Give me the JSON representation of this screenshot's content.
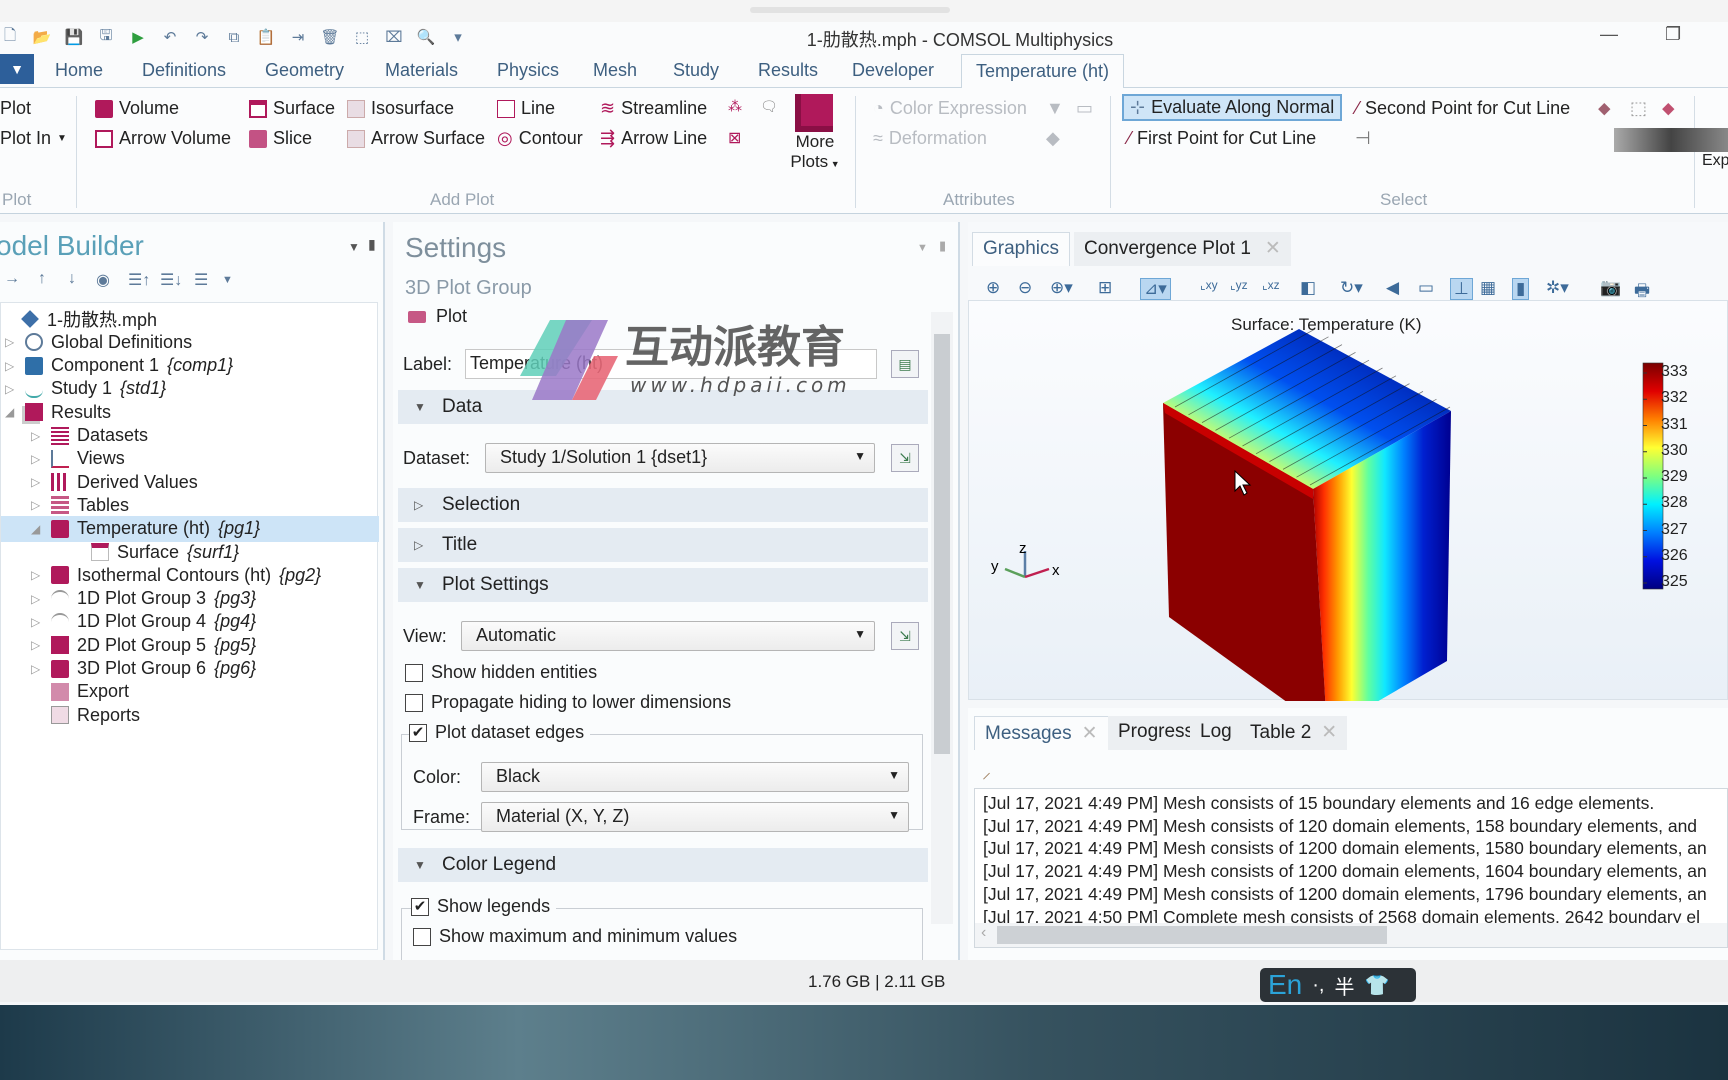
{
  "window": {
    "title": "1-肋散热.mph - COMSOL Multiphysics",
    "minimize_icon": "minimize-icon",
    "restore_icon": "restore-icon"
  },
  "quick_access": [
    "new-file-icon",
    "open-folder-icon",
    "save-icon",
    "save-as-icon",
    "run-icon",
    "undo-icon",
    "redo-icon",
    "copy-icon",
    "paste-icon",
    "duplicate-icon",
    "delete-icon",
    "select-icon",
    "clear-selection-icon",
    "find-icon",
    "dropdown-icon"
  ],
  "ribbon_tabs": [
    {
      "label": "Home"
    },
    {
      "label": "Definitions"
    },
    {
      "label": "Geometry"
    },
    {
      "label": "Materials"
    },
    {
      "label": "Physics"
    },
    {
      "label": "Mesh"
    },
    {
      "label": "Study"
    },
    {
      "label": "Results"
    },
    {
      "label": "Developer"
    },
    {
      "label": "Temperature (ht)",
      "active": true
    }
  ],
  "ribbon": {
    "plot_group": {
      "label": "Plot",
      "plot": "Plot",
      "plot_in": "Plot In"
    },
    "add_plot": {
      "label": "Add Plot",
      "volume": "Volume",
      "surface": "Surface",
      "isosurface": "Isosurface",
      "line": "Line",
      "streamline": "Streamline",
      "arrow_volume": "Arrow Volume",
      "slice": "Slice",
      "arrow_surface": "Arrow Surface",
      "contour": "Contour",
      "arrow_line": "Arrow Line",
      "more_plots_1": "More",
      "more_plots_2": "Plots"
    },
    "attributes": {
      "label": "Attributes",
      "color_expression": "Color Expression",
      "deformation": "Deformation"
    },
    "select": {
      "label": "Select",
      "evaluate_along_normal": "Evaluate Along Normal",
      "second_point": "Second Point for Cut Line",
      "first_point": "First Point for Cut Line"
    },
    "export_partial": "Exp"
  },
  "model_builder": {
    "title": "odel Builder",
    "tree": [
      {
        "label": "1-肋散热.mph",
        "tag": "",
        "level": 0,
        "icon": "model-icon",
        "toggle": ""
      },
      {
        "label": "Global Definitions",
        "tag": "",
        "level": 1,
        "icon": "globe-icon",
        "toggle": "▷"
      },
      {
        "label": "Component 1",
        "tag": "{comp1}",
        "level": 1,
        "icon": "component-icon",
        "toggle": "▷"
      },
      {
        "label": "Study 1",
        "tag": "{std1}",
        "level": 1,
        "icon": "study-icon",
        "toggle": "▷"
      },
      {
        "label": "Results",
        "tag": "",
        "level": 1,
        "icon": "results-icon",
        "toggle": "◢"
      },
      {
        "label": "Datasets",
        "tag": "",
        "level": 2,
        "icon": "datasets-icon",
        "toggle": "▷"
      },
      {
        "label": "Views",
        "tag": "",
        "level": 2,
        "icon": "views-icon",
        "toggle": "▷"
      },
      {
        "label": "Derived Values",
        "tag": "",
        "level": 2,
        "icon": "derived-values-icon",
        "toggle": "▷"
      },
      {
        "label": "Tables",
        "tag": "",
        "level": 2,
        "icon": "tables-icon",
        "toggle": "▷"
      },
      {
        "label": "Temperature (ht)",
        "tag": "{pg1}",
        "level": 2,
        "icon": "plot-group-3d-icon",
        "toggle": "◢",
        "selected": true
      },
      {
        "label": "Surface",
        "tag": "{surf1}",
        "level": 3,
        "icon": "surface-icon",
        "toggle": ""
      },
      {
        "label": "Isothermal Contours (ht)",
        "tag": "{pg2}",
        "level": 2,
        "icon": "plot-group-3d-icon",
        "toggle": "▷"
      },
      {
        "label": "1D Plot Group 3",
        "tag": "{pg3}",
        "level": 2,
        "icon": "plot-group-1d-icon",
        "toggle": "▷"
      },
      {
        "label": "1D Plot Group 4",
        "tag": "{pg4}",
        "level": 2,
        "icon": "plot-group-1d-icon",
        "toggle": "▷"
      },
      {
        "label": "2D Plot Group 5",
        "tag": "{pg5}",
        "level": 2,
        "icon": "plot-group-2d-icon",
        "toggle": "▷"
      },
      {
        "label": "3D Plot Group 6",
        "tag": "{pg6}",
        "level": 2,
        "icon": "plot-group-3d-icon",
        "toggle": "▷"
      },
      {
        "label": "Export",
        "tag": "",
        "level": 2,
        "icon": "export-icon",
        "toggle": ""
      },
      {
        "label": "Reports",
        "tag": "",
        "level": 2,
        "icon": "reports-icon",
        "toggle": ""
      }
    ]
  },
  "settings": {
    "title": "Settings",
    "subtitle": "3D Plot Group",
    "plot_button": "Plot",
    "label_caption": "Label:",
    "label_value": "Temperature (ht)",
    "sections": {
      "data": "Data",
      "selection": "Selection",
      "title": "Title",
      "plot_settings": "Plot Settings",
      "color_legend": "Color Legend"
    },
    "dataset_caption": "Dataset:",
    "dataset_value": "Study 1/Solution 1 {dset1}",
    "view_caption": "View:",
    "view_value": "Automatic",
    "show_hidden": {
      "label": "Show hidden entities",
      "checked": false
    },
    "propagate_hiding": {
      "label": "Propagate hiding to lower dimensions",
      "checked": false
    },
    "plot_dataset_edges": {
      "label": "Plot dataset edges",
      "checked": true
    },
    "color_caption": "Color:",
    "color_value": "Black",
    "frame_caption": "Frame:",
    "frame_value": "Material  (X, Y, Z)",
    "show_legends": {
      "label": "Show legends",
      "checked": true
    },
    "show_maxmin": {
      "label": "Show maximum and minimum values",
      "checked": false
    }
  },
  "watermark": {
    "brand": "互动派教育",
    "url": "www.hdpaii.com"
  },
  "graphics": {
    "tabs": [
      {
        "label": "Graphics",
        "active": true
      },
      {
        "label": "Convergence Plot 1",
        "closable": true
      }
    ],
    "toolbar": [
      "zoom-in-icon",
      "zoom-out-icon",
      "zoom-box-icon",
      "zoom-extents-icon",
      "view-default-icon",
      "view-xy-icon",
      "view-yz-icon",
      "view-xz-icon",
      "scene-light-icon",
      "rotate-icon",
      "transparency-icon",
      "wireframe-icon",
      "show-axis-icon",
      "grid-icon",
      "show-legend-icon",
      "render-icon",
      "screenshot-icon",
      "print-icon"
    ],
    "plot_title": "Surface: Temperature (K)",
    "axis": {
      "x": "x",
      "y": "y",
      "z": "z"
    },
    "legend": {
      "labels": [
        "333",
        "332",
        "331",
        "330",
        "329",
        "328",
        "327",
        "326",
        "325"
      ],
      "colormap": "Rainbow",
      "colors": [
        "#7a0000",
        "#e00000",
        "#ff8000",
        "#ffff33",
        "#7fff7f",
        "#00f0ff",
        "#0080ff",
        "#0010e0",
        "#000080"
      ]
    }
  },
  "messages": {
    "tabs": [
      {
        "label": "Messages",
        "active": true,
        "closable": true
      },
      {
        "label": "Progress"
      },
      {
        "label": "Log"
      },
      {
        "label": "Table 2",
        "closable": true
      }
    ],
    "lines": [
      "[Jul 17, 2021 4:49 PM] Mesh consists of 15 boundary elements and 16 edge elements.",
      "[Jul 17, 2021 4:49 PM] Mesh consists of 120 domain elements, 158 boundary elements, and",
      "[Jul 17, 2021 4:49 PM] Mesh consists of 1200 domain elements, 1580 boundary elements, an",
      "[Jul 17, 2021 4:49 PM] Mesh consists of 1200 domain elements, 1604 boundary elements, an",
      "[Jul 17, 2021 4:49 PM] Mesh consists of 1200 domain elements, 1796 boundary elements, an",
      "[Jul 17, 2021 4:50 PM] Complete mesh consists of 2568 domain elements, 2642 boundary el"
    ]
  },
  "status": {
    "memory": "1.76 GB | 2.11 GB"
  },
  "ime": {
    "lang": "En",
    "punct": "·,",
    "width": "半"
  }
}
